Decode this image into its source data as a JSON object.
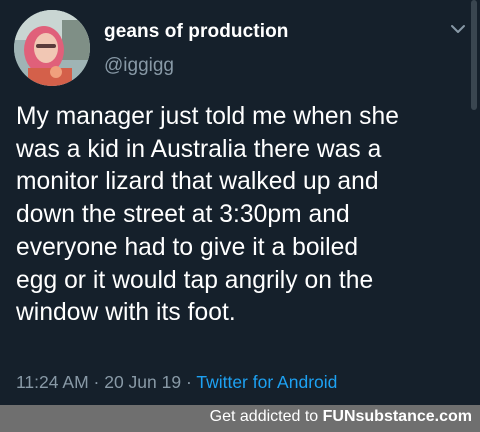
{
  "tweet": {
    "display_name": "geans of production",
    "handle": "@iggigg",
    "body": "My manager just told me when she\nwas a kid in Australia there was a\nmonitor lizard that walked up and\ndown the street at 3:30pm and\neveryone had to give it a boiled\negg or it would tap angrily on the\nwindow with its foot.",
    "time": "11:24 AM",
    "date": "20 Jun 19",
    "separator": "·",
    "source": "Twitter for Android",
    "menu_icon": "chevron-down-icon"
  },
  "footer": {
    "prefix": "Get addicted to",
    "brand": "FUNsubstance.com"
  },
  "colors": {
    "background": "#15202b",
    "text": "#ffffff",
    "secondary_text": "#8899a6",
    "link": "#1da1f2",
    "footer_bg": "#6f6f6f"
  }
}
